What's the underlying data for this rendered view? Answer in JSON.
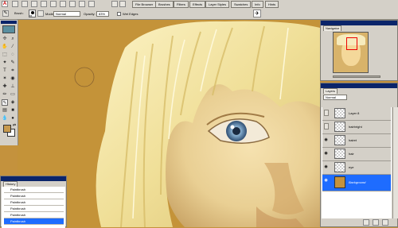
{
  "toolbar": {
    "tool_label": "Brush:",
    "brush_size": "65",
    "mode_label": "Mode:",
    "mode_value": "Normal",
    "opacity_label": "Opacity:",
    "opacity_value": "83%",
    "wet_edges_label": "Wet Edges"
  },
  "palette_well": {
    "tabs": [
      "File Browser",
      "Brushes",
      "Filters",
      "Effects",
      "Layer Styles",
      "Swatches",
      "Info",
      "Hints"
    ]
  },
  "navigator": {
    "tab_label": "Navigator"
  },
  "history": {
    "tab_label": "History",
    "items": [
      "Paintbrush",
      "Paintbrush",
      "Paintbrush",
      "Paintbrush",
      "Paintbrush",
      "Paintbrush"
    ],
    "selected_index": 5
  },
  "layers": {
    "tab_label": "Layers",
    "mode_value": "Normal",
    "items": [
      {
        "name": "Layer 8",
        "visible": false,
        "selected": false
      },
      {
        "name": "hairbright",
        "visible": false,
        "selected": false
      },
      {
        "name": "hairet",
        "visible": true,
        "selected": false
      },
      {
        "name": "hair",
        "visible": true,
        "selected": false
      },
      {
        "name": "eye",
        "visible": true,
        "selected": false
      },
      {
        "name": "Background",
        "visible": true,
        "selected": true
      }
    ]
  },
  "colors": {
    "canvas_bg": "#c4923d",
    "foreground": "#c89a4e",
    "background": "#ffffff",
    "selection": "#1e6cff",
    "chrome": "#d4d0c8"
  }
}
